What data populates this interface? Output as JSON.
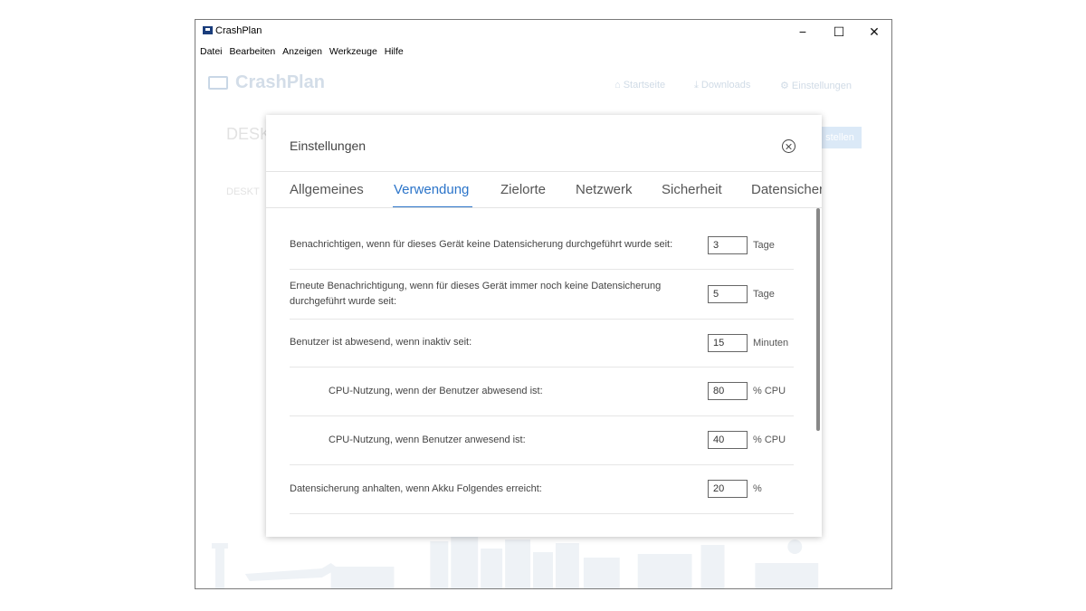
{
  "window": {
    "title": "CrashPlan",
    "min": "−",
    "max": "☐",
    "close": "✕"
  },
  "menu": [
    "Datei",
    "Bearbeiten",
    "Anzeigen",
    "Werkzeuge",
    "Hilfe"
  ],
  "background": {
    "logo": "CrashPlan",
    "nav": {
      "home": "⌂ Startseite",
      "downloads": "⤓ Downloads",
      "settings": "⚙ Einstellungen"
    },
    "device_title": "DESK",
    "device_sub": "DESKT",
    "button": "stellen"
  },
  "dialog": {
    "title": "Einstellungen",
    "tabs": [
      "Allgemeines",
      "Verwendung",
      "Zielorte",
      "Netzwerk",
      "Sicherheit",
      "Datensicherungssätze"
    ],
    "active_tab": 1,
    "rows": [
      {
        "label": "Benachrichtigen, wenn für dieses Gerät keine Datensicherung durchgeführt wurde seit:",
        "value": "3",
        "unit": "Tage",
        "indent": false
      },
      {
        "label": "Erneute Benachrichtigung, wenn für dieses Gerät immer noch keine Datensicherung durchgeführt wurde seit:",
        "value": "5",
        "unit": "Tage",
        "indent": false
      },
      {
        "label": "Benutzer ist abwesend, wenn inaktiv seit:",
        "value": "15",
        "unit": "Minuten",
        "indent": false
      },
      {
        "label": "CPU-Nutzung, wenn der Benutzer abwesend ist:",
        "value": "80",
        "unit": "% CPU",
        "indent": true
      },
      {
        "label": "CPU-Nutzung, wenn Benutzer anwesend ist:",
        "value": "40",
        "unit": "% CPU",
        "indent": true
      },
      {
        "label": "Datensicherung anhalten, wenn Akku Folgendes erreicht:",
        "value": "20",
        "unit": "%",
        "indent": false
      }
    ]
  },
  "colors": {
    "accent": "#2b74c9",
    "brand_dark": "#1a3d7c"
  }
}
